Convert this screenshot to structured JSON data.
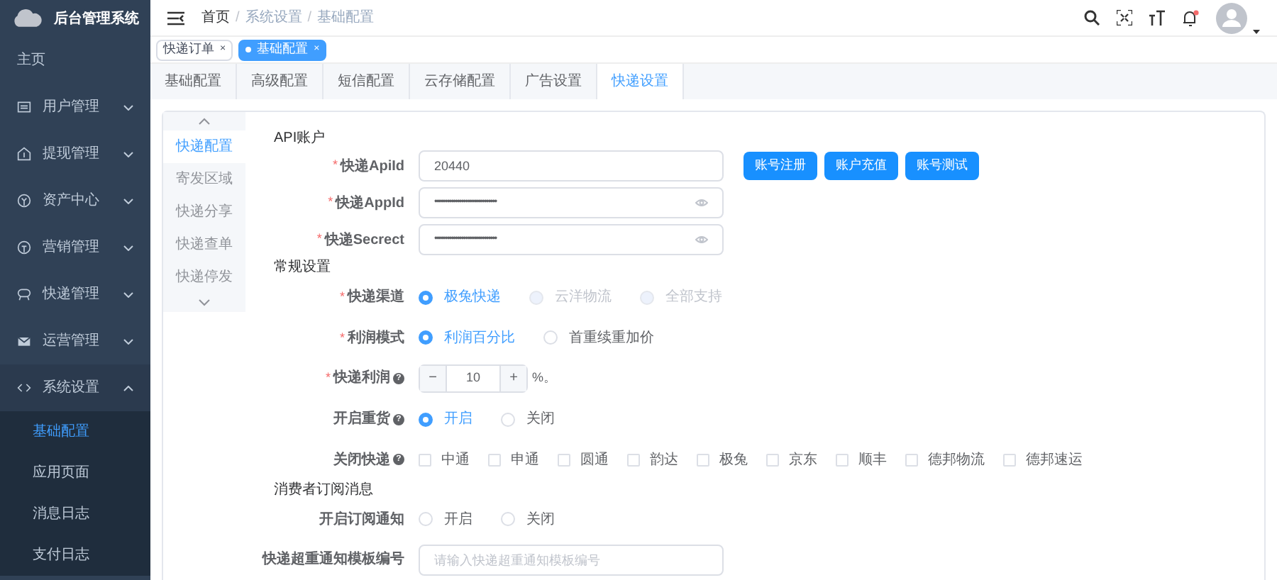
{
  "app": {
    "title": "后台管理系统"
  },
  "sidebar": {
    "items": [
      {
        "label": "主页"
      },
      {
        "label": "用户管理",
        "expanded": false
      },
      {
        "label": "提现管理",
        "expanded": false
      },
      {
        "label": "资产中心",
        "expanded": false
      },
      {
        "label": "营销管理",
        "expanded": false
      },
      {
        "label": "快递管理",
        "expanded": false
      },
      {
        "label": "运营管理",
        "expanded": false
      },
      {
        "label": "系统设置",
        "expanded": true,
        "children": [
          {
            "label": "基础配置",
            "selected": true
          },
          {
            "label": "应用页面",
            "selected": false
          },
          {
            "label": "消息日志",
            "selected": false
          },
          {
            "label": "支付日志",
            "selected": false
          }
        ]
      }
    ]
  },
  "breadcrumb": [
    {
      "kind": "link",
      "text": "首页"
    },
    {
      "kind": "separator",
      "text": "/"
    },
    {
      "kind": "link",
      "text": "系统设置"
    },
    {
      "kind": "separator",
      "text": "/"
    },
    {
      "kind": "current",
      "text": "基础配置"
    }
  ],
  "tags": [
    {
      "label": "快递订单",
      "close": "×",
      "selected": false
    },
    {
      "label": "基础配置",
      "close": "×",
      "selected": true
    }
  ],
  "tabs": [
    {
      "label": "基础配置",
      "selected": false
    },
    {
      "label": "高级配置",
      "selected": false
    },
    {
      "label": "短信配置",
      "selected": false
    },
    {
      "label": "云存储配置",
      "selected": false
    },
    {
      "label": "广告设置",
      "selected": false
    },
    {
      "label": "快递设置",
      "selected": true
    }
  ],
  "side_tabs": [
    {
      "label": "快递配置",
      "selected": true
    },
    {
      "label": "寄发区域",
      "selected": false
    },
    {
      "label": "快递分享",
      "selected": false
    },
    {
      "label": "快递查单",
      "selected": false
    },
    {
      "label": "快递停发",
      "selected": false
    }
  ],
  "sections": [
    {
      "title": "API账户",
      "rows": [
        {
          "kind": "input",
          "label": "快递ApiId",
          "required_mark": "*",
          "value": "20440",
          "buttons": [
            "账号注册",
            "账户充值",
            "账号测试"
          ]
        },
        {
          "kind": "password",
          "label": "快递AppId",
          "required_mark": "*",
          "value": "••••••••••••••••••••••••••••••"
        },
        {
          "kind": "password",
          "label": "快递Secrect",
          "required_mark": "*",
          "value": "••••••••••••••••••••••••••••••"
        }
      ]
    },
    {
      "title": "常规设置",
      "rows": [
        {
          "kind": "radio",
          "label": "快递渠道",
          "required_mark": "*",
          "options": [
            {
              "label": "极兔快递",
              "selected": true,
              "disabled": false
            },
            {
              "label": "云洋物流",
              "selected": false,
              "disabled": true
            },
            {
              "label": "全部支持",
              "selected": false,
              "disabled": true
            }
          ]
        },
        {
          "kind": "radio",
          "label": "利润模式",
          "required_mark": "*",
          "options": [
            {
              "label": "利润百分比",
              "selected": true,
              "disabled": false
            },
            {
              "label": "首重续重加价",
              "selected": false,
              "disabled": false
            }
          ]
        },
        {
          "kind": "stepper",
          "label": "快递利润",
          "required_mark": "*",
          "help": "?",
          "minus": "−",
          "value": "10",
          "plus": "+",
          "suffix": "%。"
        },
        {
          "kind": "radio",
          "label": "开启重货",
          "help": "?",
          "options": [
            {
              "label": "开启",
              "selected": true,
              "disabled": false
            },
            {
              "label": "关闭",
              "selected": false,
              "disabled": false
            }
          ]
        },
        {
          "kind": "checkbox",
          "label": "关闭快递",
          "help": "?",
          "options": [
            {
              "label": "中通",
              "checked": false
            },
            {
              "label": "申通",
              "checked": false
            },
            {
              "label": "圆通",
              "checked": false
            },
            {
              "label": "韵达",
              "checked": false
            },
            {
              "label": "极兔",
              "checked": false
            },
            {
              "label": "京东",
              "checked": false
            },
            {
              "label": "顺丰",
              "checked": false
            },
            {
              "label": "德邦物流",
              "checked": false
            },
            {
              "label": "德邦速运",
              "checked": false
            }
          ]
        }
      ]
    },
    {
      "title": "消费者订阅消息",
      "rows": [
        {
          "kind": "radio",
          "label": "开启订阅通知",
          "options": [
            {
              "label": "开启",
              "selected": false,
              "disabled": false
            },
            {
              "label": "关闭",
              "selected": false,
              "disabled": false
            }
          ]
        },
        {
          "kind": "input",
          "label": "快递超重通知模板编号",
          "placeholder": "请输入快递超重通知模板编号"
        }
      ]
    }
  ]
}
